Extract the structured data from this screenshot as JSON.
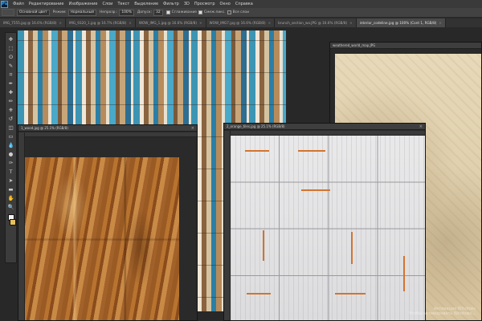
{
  "app": {
    "logo": "Ps"
  },
  "menu": [
    "Файл",
    "Редактирование",
    "Изображение",
    "Слои",
    "Текст",
    "Выделение",
    "Фильтр",
    "3D",
    "Просмотр",
    "Окно",
    "Справка"
  ],
  "options_bar": {
    "select_value": "Основной цвет",
    "mode_label": "Режим:",
    "mode_value": "Нормальный",
    "opacity_label": "Непрозр.:",
    "opacity_value": "100%",
    "tolerance_label": "Допуск:",
    "tolerance_value": "32",
    "antialias_label": "Сглаживание",
    "contiguous_label": "Смеж.пикс.",
    "all_layers_label": "Все слои"
  },
  "tabs": [
    "IMG_7555.jpg @ 16.6% (RGB/8)",
    "IMG_9320_1.jpg @ 16.7% (RGB/8)",
    "WOW_IMG_1.jpg @ 16.6% (RGB/8)",
    "WOW_IMG7.jpg @ 16.6% (RGB/8)",
    "brunch_section_wo.JPG @ 16.6% (RGB/8)",
    "interior_codeline.jpg @ 100% (Cont 1, RGB/8)"
  ],
  "documents": {
    "map_title": "weathered_world_map.JPG",
    "wood_title": "1_wood.jpg @ 25.1% (RGB/8)",
    "white_title": "2_orange_tiles.jpg @ 25.1% (RGB/8)"
  },
  "toolbar": {
    "tools": [
      "move-icon",
      "marquee-icon",
      "lasso-icon",
      "quick-select-icon",
      "crop-icon",
      "eyedropper-icon",
      "healing-icon",
      "brush-icon",
      "stamp-icon",
      "history-brush-icon",
      "eraser-icon",
      "gradient-icon",
      "blur-icon",
      "dodge-icon",
      "pen-icon",
      "type-icon",
      "path-select-icon",
      "shape-icon",
      "hand-icon",
      "zoom-icon"
    ],
    "glyphs": [
      "✥",
      "⬚",
      "ʘ",
      "✎",
      "⌗",
      "✒",
      "✚",
      "✏",
      "⎈",
      "↺",
      "◫",
      "▭",
      "💧",
      "●",
      "✑",
      "T",
      "➤",
      "▬",
      "✋",
      "🔍"
    ]
  },
  "colors": {
    "foreground": "#f2f2f2",
    "background": "#e6c060"
  },
  "watermark": {
    "line1": "Активация Windows",
    "line2": "Чтобы активировать Windows..."
  }
}
